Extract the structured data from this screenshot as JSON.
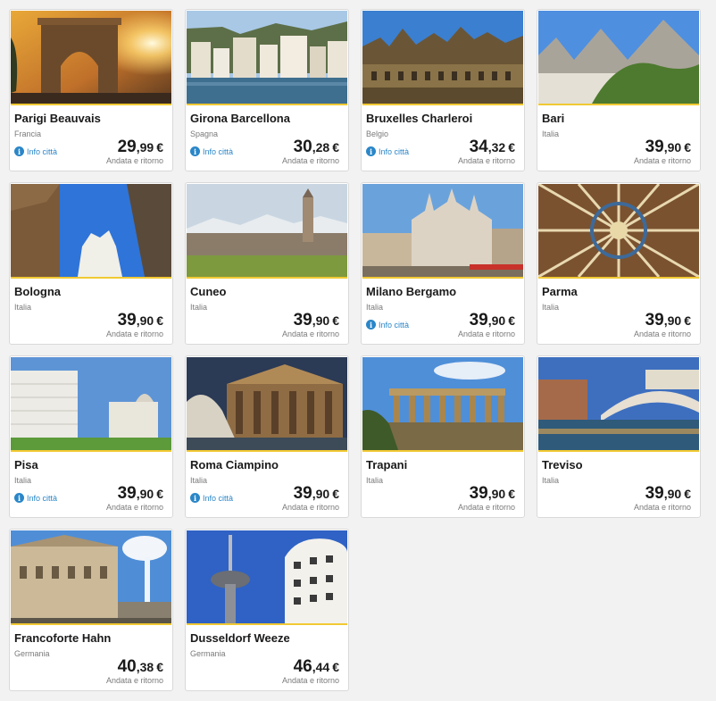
{
  "destinations": [
    {
      "name": "Parigi Beauvais",
      "country": "Francia",
      "info": "Info città",
      "price_int": "29",
      "price_dec": ",99",
      "currency": "€",
      "trip": "Andata e ritorno"
    },
    {
      "name": "Girona Barcellona",
      "country": "Spagna",
      "info": "Info città",
      "price_int": "30",
      "price_dec": ",28",
      "currency": "€",
      "trip": "Andata e ritorno"
    },
    {
      "name": "Bruxelles Charleroi",
      "country": "Belgio",
      "info": "Info città",
      "price_int": "34",
      "price_dec": ",32",
      "currency": "€",
      "trip": "Andata e ritorno"
    },
    {
      "name": "Bari",
      "country": "Italia",
      "price_int": "39",
      "price_dec": ",90",
      "currency": "€",
      "trip": "Andata e ritorno"
    },
    {
      "name": "Bologna",
      "country": "Italia",
      "price_int": "39",
      "price_dec": ",90",
      "currency": "€",
      "trip": "Andata e ritorno"
    },
    {
      "name": "Cuneo",
      "country": "Italia",
      "price_int": "39",
      "price_dec": ",90",
      "currency": "€",
      "trip": "Andata e ritorno"
    },
    {
      "name": "Milano Bergamo",
      "country": "Italia",
      "info": "Info città",
      "price_int": "39",
      "price_dec": ",90",
      "currency": "€",
      "trip": "Andata e ritorno"
    },
    {
      "name": "Parma",
      "country": "Italia",
      "price_int": "39",
      "price_dec": ",90",
      "currency": "€",
      "trip": "Andata e ritorno"
    },
    {
      "name": "Pisa",
      "country": "Italia",
      "info": "Info città",
      "price_int": "39",
      "price_dec": ",90",
      "currency": "€",
      "trip": "Andata e ritorno"
    },
    {
      "name": "Roma Ciampino",
      "country": "Italia",
      "info": "Info città",
      "price_int": "39",
      "price_dec": ",90",
      "currency": "€",
      "trip": "Andata e ritorno"
    },
    {
      "name": "Trapani",
      "country": "Italia",
      "price_int": "39",
      "price_dec": ",90",
      "currency": "€",
      "trip": "Andata e ritorno"
    },
    {
      "name": "Treviso",
      "country": "Italia",
      "price_int": "39",
      "price_dec": ",90",
      "currency": "€",
      "trip": "Andata e ritorno"
    },
    {
      "name": "Francoforte Hahn",
      "country": "Germania",
      "price_int": "40",
      "price_dec": ",38",
      "currency": "€",
      "trip": "Andata e ritorno"
    },
    {
      "name": "Dusseldorf Weeze",
      "country": "Germania",
      "price_int": "46",
      "price_dec": ",44",
      "currency": "€",
      "trip": "Andata e ritorno"
    }
  ],
  "colors": {
    "accent": "#f1c933",
    "link": "#2a86c8",
    "text": "#1a1a1a",
    "muted": "#7a7a7a"
  }
}
